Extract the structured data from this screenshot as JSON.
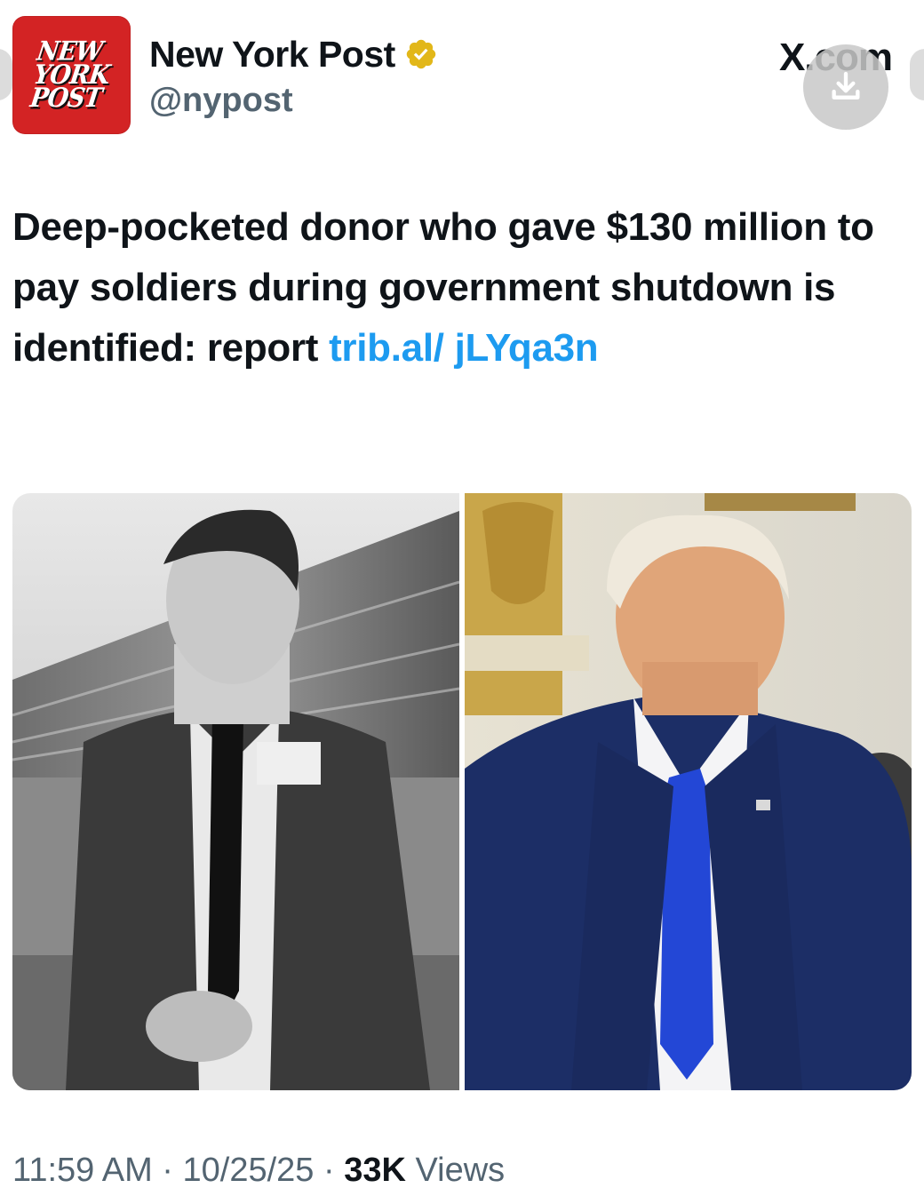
{
  "account": {
    "logo_lines": [
      "NEW",
      "YORK",
      "POST"
    ],
    "display_name": "New York Post",
    "handle": "@nypost",
    "verified": true,
    "verified_color": "#e2b719"
  },
  "site": "X.com",
  "icons": {
    "verified": "verified-badge-icon",
    "download": "download-icon"
  },
  "tweet": {
    "text": "Deep-pocketed donor who gave $130 million to pay soldiers during government shutdown is identified: report ",
    "link": "trib.al/ jLYqa3n"
  },
  "meta": {
    "time": "11:59 AM",
    "sep1": " · ",
    "date": "10/25/25",
    "sep2": " · ",
    "views_count": "33K",
    "views_label": " Views"
  },
  "colors": {
    "brand_red": "#d32324",
    "link_blue": "#1d9bf0",
    "muted_gray": "#536471"
  }
}
